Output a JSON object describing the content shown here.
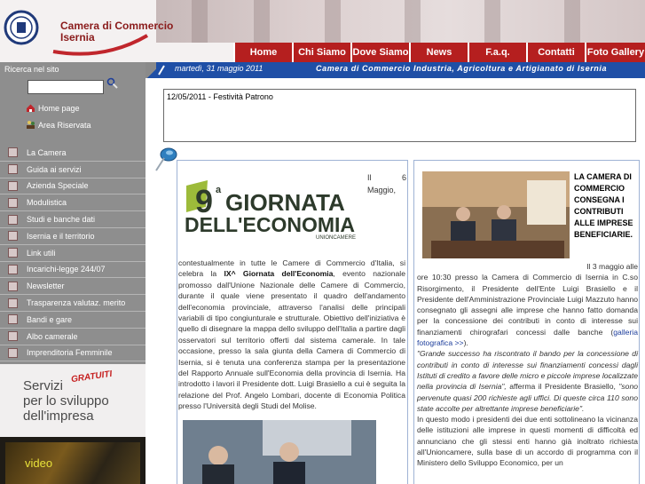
{
  "header": {
    "org_line1": "Camera di Commercio",
    "org_line2": "Isernia",
    "nav": [
      {
        "label": "Home",
        "w": 66
      },
      {
        "label": "Chi Siamo",
        "w": 66
      },
      {
        "label": "Dove Siamo",
        "w": 66
      },
      {
        "label": "News",
        "w": 66
      },
      {
        "label": "F.a.q.",
        "w": 66
      },
      {
        "label": "Contatti",
        "w": 66
      },
      {
        "label": "Foto Gallery",
        "w": 68
      }
    ]
  },
  "datebar": {
    "date": "martedì, 31 maggio 2011",
    "org": "Camera di Commercio Industria, Agricoltura e Artigianato di Isernia"
  },
  "sidebar": {
    "search_label": "Ricerca nel sito",
    "search_value": "",
    "home_link": "Home page",
    "reserved_link": "Area Riservata",
    "menu": [
      "La Camera",
      "Guida ai servizi",
      "Azienda Speciale",
      "Modulistica",
      "Studi e banche dati",
      "Isernia e il territorio",
      "Link utili",
      "Incarichi-legge 244/07",
      "Newsletter",
      "Trasparenza valutaz. merito",
      "Bandi e gare",
      "Albo camerale",
      "Imprenditoria Femminile"
    ],
    "banner": {
      "line1": "Servizi",
      "badge": "GRATUITI",
      "line2": "per lo sviluppo",
      "line3": "dell'impresa"
    },
    "video_label": "video"
  },
  "notice": {
    "text": "12/05/2011 - Festività Patrono"
  },
  "article1": {
    "logo_number": "9",
    "logo_sup": "a",
    "logo_line1": "GIORNATA",
    "logo_line2": "DELL'ECONOMIA",
    "logo_brand": "UNIONCAMERE",
    "lead": "Il 6 Maggio,",
    "body_intro": "contestualmente in tutte le Camere di Commercio d'Italia, si celebra la ",
    "body_bold": "IX^ Giornata dell'Economia",
    "body_rest": ", evento nazionale promosso dall'Unione Nazionale delle Camere di Commercio, durante il quale viene presentato il quadro dell'andamento dell'economia provinciale, attraverso l'analisi delle principali variabili di tipo congiunturale e strutturale. Obiettivo dell'iniziativa è quello di disegnare la mappa dello sviluppo dell'Italia a partire dagli osservatori sul territorio offerti dal sistema camerale. In tale occasione, presso la sala giunta della Camera di Commercio di Isernia, si è tenuta una conferenza stampa per la presentazione del Rapporto Annuale sull'Economia della provincia di Isernia. Ha introdotto i lavori il Presidente dott. Luigi Brasiello a cui è seguita la relazione del Prof. Angelo Lombari, docente di Economia Politica presso l'Università degli Studi del Molise."
  },
  "article2": {
    "title": "LA CAMERA DI COMMERCIO CONSEGNA I CONTRIBUTI ALLE IMPRESE BENEFICIARIE.",
    "p1_lead": "Il 3 maggio alle",
    "p1": "ore 10:30 presso la Camera di Commercio di Isernia in C.so Risorgimento, il Presidente dell'Ente Luigi Brasiello e il Presidente dell'Amministrazione Provinciale Luigi Mazzuto hanno consegnato gli assegni alle imprese che hanno fatto domanda per la concessione dei contributi in conto di interesse sui finanziamenti chirografari concessi dalle banche (",
    "p1_link": "galleria fotografica >>",
    "p1_end": ").",
    "quote1": "\"Grande successo ha riscontrato il bando per la concessione di contributi in conto di interesse sui finanziamenti concessi dagli Istituti di credito a favore delle micro e piccole imprese localizzate nella provincia di Isernia\",",
    "quote1_after": " afferma il Presidente Brasiello, ",
    "quote2": "\"sono pervenute quasi 200 richieste agli uffici. Di queste circa 110 sono state accolte per altrettante imprese beneficiarie\".",
    "p2": "In questo modo i presidenti dei due enti sottolineano la vicinanza delle istituzioni alle imprese in questi momenti di difficoltà ed annunciano che gli stessi enti hanno già inoltrato richiesta all'Unioncamere, sulla base di un accordo di programma con il Ministero dello Sviluppo Economico, per un"
  }
}
